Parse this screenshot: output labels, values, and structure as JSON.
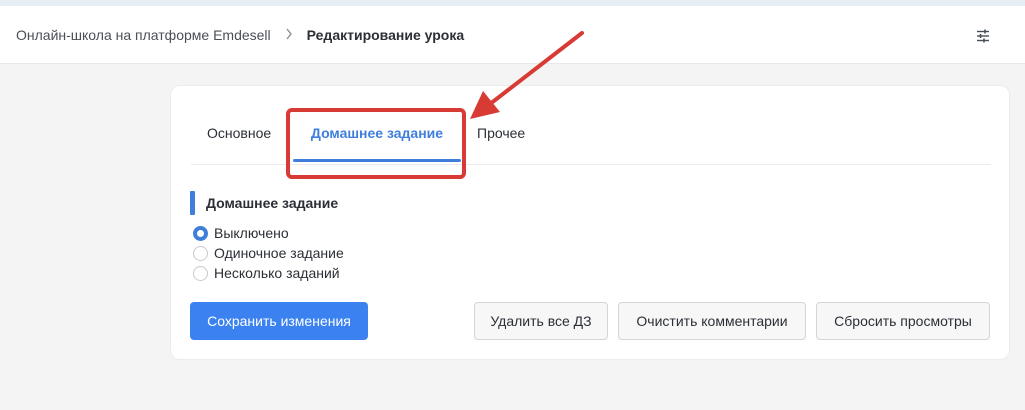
{
  "header": {
    "breadcrumb": {
      "parent": "Онлайн-школа на платформе Emdesell",
      "separator": ">",
      "current": "Редактирование урока"
    },
    "settings_icon": "sliders-icon"
  },
  "tabs": [
    {
      "label": "Основное",
      "active": false
    },
    {
      "label": "Домашнее задание",
      "active": true
    },
    {
      "label": "Прочее",
      "active": false
    }
  ],
  "homework": {
    "title": "Домашнее задание",
    "options": [
      {
        "label": "Выключено",
        "selected": true
      },
      {
        "label": "Одиночное задание",
        "selected": false
      },
      {
        "label": "Несколько заданий",
        "selected": false
      }
    ]
  },
  "buttons": {
    "save": "Сохранить изменения",
    "delete_all": "Удалить все ДЗ",
    "clear_comments": "Очистить комментарии",
    "reset_views": "Сбросить просмотры"
  },
  "annotation": {
    "color": "#d83a34",
    "type": "arrow-and-box"
  },
  "colors": {
    "accent": "#3f7fdb",
    "primary_button": "#3b82f0"
  }
}
